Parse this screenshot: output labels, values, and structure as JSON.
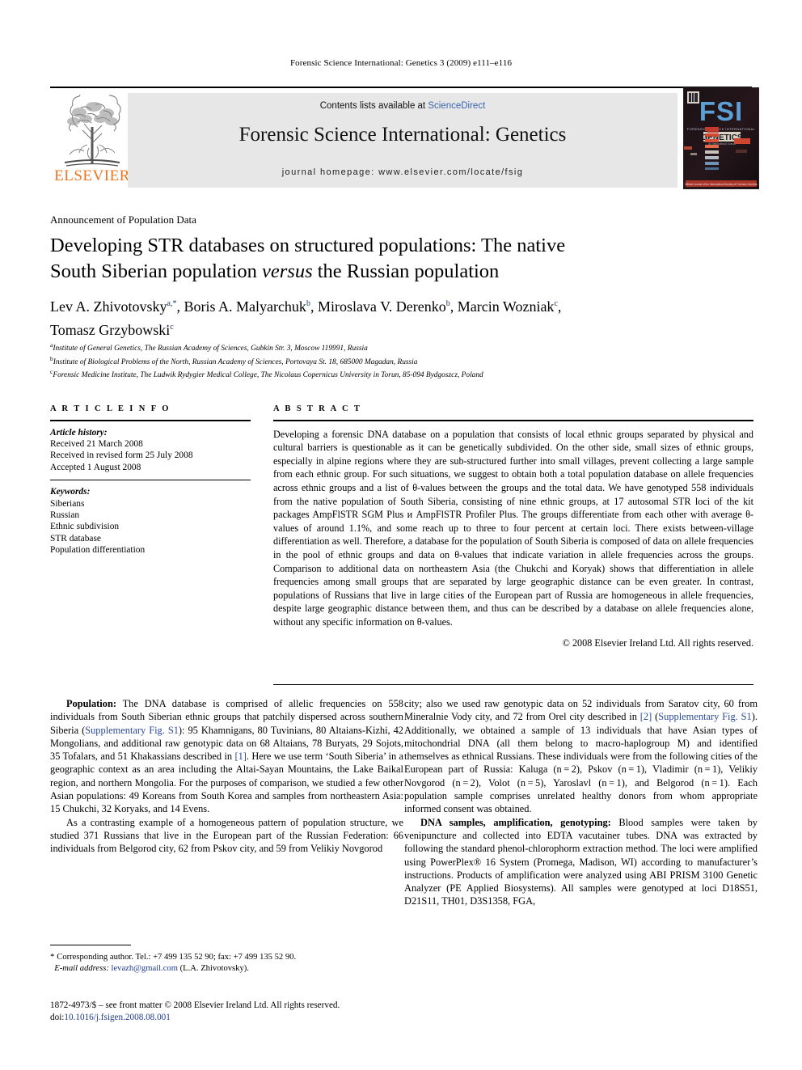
{
  "running_head": "Forensic Science International: Genetics 3 (2009) e111–e116",
  "masthead": {
    "contents_prefix": "Contents lists available at ",
    "sciencedirect": "ScienceDirect",
    "journal_title": "Forensic Science International: Genetics",
    "homepage": "journal homepage: www.elsevier.com/locate/fsig",
    "publisher_wordmark": "ELSEVIER",
    "publisher_color": "#E87722",
    "link_color": "#3a64b0",
    "band_color": "#e7e7e7",
    "cover": {
      "title": "FSI",
      "subtitle": "GENETICS",
      "kicker": "FORENSIC SCIENCE INTERNATIONAL"
    }
  },
  "article": {
    "section_label": "Announcement of Population Data",
    "title_line1": "Developing STR databases on structured populations: The native",
    "title_line2_pre": "South Siberian population ",
    "title_line2_em": "versus",
    "title_line2_post": " the Russian population",
    "authors": [
      {
        "name": "Lev A. Zhivotovsky",
        "marks": "a,*",
        "sep": ", "
      },
      {
        "name": "Boris A. Malyarchuk",
        "marks": "b",
        "sep": ", "
      },
      {
        "name": "Miroslava V. Derenko",
        "marks": "b",
        "sep": ", "
      },
      {
        "name": "Marcin Wozniak",
        "marks": "c",
        "sep": ","
      },
      {
        "name": "Tomasz Grzybowski",
        "marks": "c",
        "sep": ""
      }
    ],
    "affiliations": [
      {
        "mark": "a",
        "text": "Institute of General Genetics, The Russian Academy of Sciences, Gubkin Str. 3, Moscow 119991, Russia"
      },
      {
        "mark": "b",
        "text": "Institute of Biological Problems of the North, Russian Academy of Sciences, Portovaya St. 18, 685000 Magadan, Russia"
      },
      {
        "mark": "c",
        "text": "Forensic Medicine Institute, The Ludwik Rydygier Medical College, The Nicolaus Copernicus University in Torun, 85-094 Bydgoszcz, Poland"
      }
    ]
  },
  "article_info": {
    "heading": "A R T I C L E  I N F O",
    "history_label": "Article history:",
    "history": [
      "Received 21 March 2008",
      "Received in revised form 25 July 2008",
      "Accepted 1 August 2008"
    ],
    "keywords_label": "Keywords:",
    "keywords": [
      "Siberians",
      "Russian",
      "Ethnic subdivision",
      "STR database",
      "Population differentiation"
    ]
  },
  "abstract": {
    "heading": "A B S T R A C T",
    "text": "Developing a forensic DNA database on a population that consists of local ethnic groups separated by physical and cultural barriers is questionable as it can be genetically subdivided. On the other side, small sizes of ethnic groups, especially in alpine regions where they are sub-structured further into small villages, prevent collecting a large sample from each ethnic group. For such situations, we suggest to obtain both a total population database on allele frequencies across ethnic groups and a list of θ-values between the groups and the total data. We have genotyped 558 individuals from the native population of South Siberia, consisting of nine ethnic groups, at 17 autosomal STR loci of the kit packages AmpFlSTR SGM Plus и AmpFlSTR Profiler Plus. The groups differentiate from each other with average θ-values of around 1.1%, and some reach up to three to four percent at certain loci. There exists between-village differentiation as well. Therefore, a database for the population of South Siberia is composed of data on allele frequencies in the pool of ethnic groups and data on θ-values that indicate variation in allele frequencies across the groups. Comparison to additional data on northeastern Asia (the Chukchi and Koryak) shows that differentiation in allele frequencies among small groups that are separated by large geographic distance can be even greater. In contrast, populations of Russians that live in large cities of the European part of Russia are homogeneous in allele frequencies, despite large geographic distance between them, and thus can be described by a database on allele frequencies alone, without any specific information on θ-values.",
    "copyright": "© 2008 Elsevier Ireland Ltd. All rights reserved."
  },
  "body": {
    "left": {
      "para1_label": "Population:",
      "para1_a": " The DNA database is comprised of allelic frequencies on 558 individuals from South Siberian ethnic groups that patchily dispersed across southern Siberia (",
      "para1_link1": "Supplementary Fig. S1",
      "para1_b": "): 95 Khamnigans, 80 Tuvinians, 80 Altaians-Kizhi, 42 Mongolians, and additional raw genotypic data on 68 Altaians, 78 Buryats, 29 Sojots, 35 Tofalars, and 51 Khakassians described in ",
      "para1_link2": "[1]",
      "para1_c": ". Here we use term ‘South Siberia’ in a geographic context as an area including the Altai-Sayan Mountains, the Lake Baikal region, and northern Mongolia. For the purposes of comparison, we studied a few other Asian populations: 49 Koreans from South Korea and samples from northeastern Asia: 15 Chukchi, 32 Koryaks, and 14 Evens.",
      "para2": "As a contrasting example of a homogeneous pattern of population structure, we studied 371 Russians that live in the European part of the Russian Federation: 66 individuals from Belgorod city, 62 from Pskov city, and 59 from Velikiy Novgorod"
    },
    "right": {
      "para1_a": "city; also we used raw genotypic data on 52 individuals from Saratov city, 60 from Mineralnie Vody city, and 72 from Orel city described in ",
      "para1_link1": "[2]",
      "para1_b": " (",
      "para1_link2": "Supplementary Fig. S1",
      "para1_c": "). Additionally, we obtained a sample of 13 individuals that have Asian types of mitochondrial DNA (all them belong to macro-haplogroup M) and identified themselves as ethnical Russians. These individuals were from the following cities of the European part of Russia: Kaluga (n = 2), Pskov (n = 1), Vladimir (n = 1), Velikiy Novgorod (n = 2), Volot (n = 5), Yaroslavl (n = 1), and Belgorod (n = 1). Each population sample comprises unrelated healthy donors from whom appropriate informed consent was obtained.",
      "para2_label": "DNA samples, amplification, genotyping:",
      "para2_a": " Blood samples were taken by venipuncture and collected into EDTA vacutainer tubes. DNA was extracted by following the standard phenol-chlorophorm extraction method. The loci were amplified using PowerPlex® 16 System (Promega, Madison, WI) according to manufacturer’s instructions. Products of amplification were analyzed using ABI PRISM 3100 Genetic Analyzer (PE Applied Biosystems). All samples were genotyped at loci D18S51, D21S11, TH01, D3S1358, FGA,"
    }
  },
  "footnote": {
    "corresponding": "Corresponding author. Tel.: +7 499 135 52 90; fax: +7 499 135 52 90.",
    "email_label": "E-mail address:",
    "email": "levazh@gmail.com",
    "email_owner": " (L.A. Zhivotovsky)."
  },
  "footer": {
    "issn_line": "1872-4973/$ – see front matter © 2008 Elsevier Ireland Ltd. All rights reserved.",
    "doi_label": "doi:",
    "doi": "10.1016/j.fsigen.2008.08.001"
  }
}
